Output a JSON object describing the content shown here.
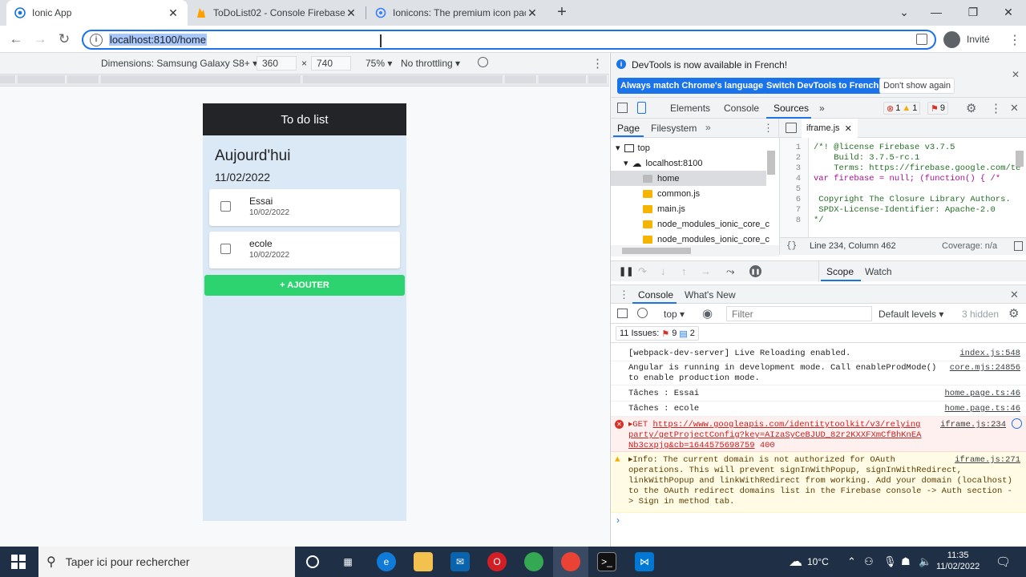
{
  "browser": {
    "tabs": [
      {
        "title": "Ionic App",
        "active": true
      },
      {
        "title": "ToDoList02 - Console Firebase",
        "active": false
      },
      {
        "title": "Ionicons: The premium icon pack",
        "active": false
      }
    ],
    "url": "localhost:8100/home",
    "profile_label": "Invité"
  },
  "device_toolbar": {
    "dimensions_label": "Dimensions: Samsung Galaxy S8+",
    "width": "360",
    "height": "740",
    "times": "×",
    "zoom": "75%",
    "throttling": "No throttling"
  },
  "app": {
    "header_title": "To do list",
    "page_title": "Aujourd'hui",
    "date": "11/02/2022",
    "tasks": [
      {
        "name": "Essai",
        "date": "10/02/2022",
        "checked": false
      },
      {
        "name": "ecole",
        "date": "10/02/2022",
        "checked": false
      }
    ],
    "add_button": "+ AJOUTER"
  },
  "devtools": {
    "info_text": "DevTools is now available in French!",
    "info_buttons": [
      "Always match Chrome's language",
      "Switch DevTools to French",
      "Don't show again"
    ],
    "main_tabs": [
      "Elements",
      "Console",
      "Sources"
    ],
    "active_main_tab": "Sources",
    "counts": {
      "errors": "1",
      "warnings": "1",
      "issues": "9"
    },
    "nav_tabs": [
      "Page",
      "Filesystem"
    ],
    "tree": {
      "top": "top",
      "origin": "localhost:8100",
      "files": [
        "home",
        "common.js",
        "main.js",
        "node_modules_ionic_core_c",
        "node_modules_ionic_core_c"
      ]
    },
    "open_file": "iframe.js",
    "code_lines": [
      {
        "n": "1",
        "text": "/*! @license Firebase v3.7.5"
      },
      {
        "n": "2",
        "text": "    Build: 3.7.5-rc.1"
      },
      {
        "n": "3",
        "text": "    Terms: https://firebase.google.com/te"
      },
      {
        "n": "4",
        "text": "var firebase = null; (function() { /*"
      },
      {
        "n": "5",
        "text": ""
      },
      {
        "n": "6",
        "text": " Copyright The Closure Library Authors."
      },
      {
        "n": "7",
        "text": " SPDX-License-Identifier: Apache-2.0"
      },
      {
        "n": "8",
        "text": "*/"
      }
    ],
    "cursor_pos": "Line 234, Column 462",
    "coverage": "Coverage: n/a",
    "debug_tabs": [
      "Scope",
      "Watch"
    ],
    "drawer_tabs": [
      "Console",
      "What's New"
    ],
    "console_context": "top",
    "filter_placeholder": "Filter",
    "levels": "Default levels",
    "hidden": "3 hidden",
    "issues_label": "11 Issues:",
    "issues_err": "9",
    "issues_info": "2",
    "console_lines": [
      {
        "msg": "[webpack-dev-server] Live Reloading enabled.",
        "src": "index.js:548",
        "type": "log"
      },
      {
        "msg": "Angular is running in development mode. Call enableProdMode()\nto enable production mode.",
        "src": "core.mjs:24856",
        "type": "log"
      },
      {
        "msg": "Tâches : Essai",
        "src": "home.page.ts:46",
        "type": "log"
      },
      {
        "msg": "Tâches : ecole",
        "src": "home.page.ts:46",
        "type": "log"
      }
    ],
    "error_line": {
      "prefix": "▸GET ",
      "url_lines": [
        "https://www.googleapis.com/identitytoolkit/v3/relying",
        "party/getProjectConfig?key=AIzaSyCeBJUD_82r2KXXFXmCfBhKnEA",
        "Nb3cxpjg&cb=1644575698759"
      ],
      "status": " 400",
      "src": "iframe.js:234"
    },
    "warn_line": {
      "msg": "▸Info: The current domain is not authorized for OAuth\noperations. This will prevent signInWithPopup, signInWithRedirect,\nlinkWithPopup and linkWithRedirect from working. Add your domain (localhost)\nto the OAuth redirect domains list in the Firebase console -> Auth section -\n> Sign in method tab.",
      "src": "iframe.js:271"
    }
  },
  "taskbar": {
    "search_placeholder": "Taper ici pour rechercher",
    "weather": "10°C",
    "time": "11:35",
    "date": "11/02/2022"
  }
}
